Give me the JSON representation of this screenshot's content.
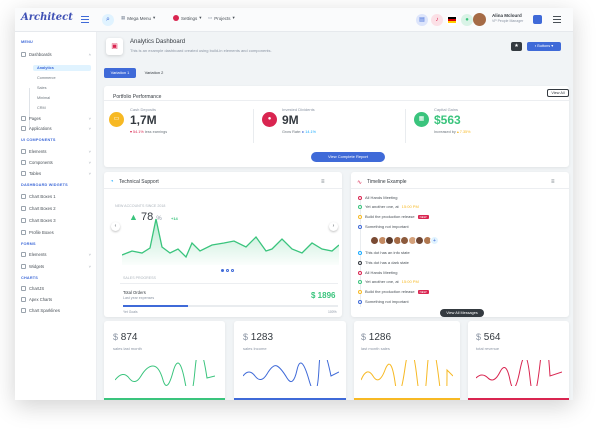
{
  "app": {
    "logo": "Architect"
  },
  "header": {
    "mega_menu": "Mega Menu",
    "settings": "Settings",
    "projects": "Projects",
    "user_name": "Alina Mclourd",
    "user_role": "VP People Manager"
  },
  "sidebar": {
    "menu_head": "MENU",
    "dashboards": "Dashboards",
    "dash_items": [
      "Analytics",
      "Commerce",
      "Sales",
      "Minimal",
      "CRM"
    ],
    "pages": "Pages",
    "applications": "Applications",
    "ui_head": "UI COMPONENTS",
    "elements": "Elements",
    "components": "Components",
    "tables": "Tables",
    "widgets_head": "DASHBOARD WIDGETS",
    "widgets": [
      "Chart Boxes 1",
      "Chart Boxes 2",
      "Chart Boxes 3",
      "Profile Boxes"
    ],
    "forms_head": "FORMS",
    "form_elements": "Elements",
    "form_widgets": "Widgets",
    "charts_head": "CHARTS",
    "charts": [
      "ChartJS",
      "Apex Charts",
      "Chart Sparklines"
    ]
  },
  "page": {
    "title": "Analytics Dashboard",
    "subtitle": "This is an example dashboard created using build-in elements and components.",
    "btn_label": "Buttons",
    "tabs": [
      "Variation 1",
      "Variation 2"
    ]
  },
  "portfolio": {
    "title": "Portfolio Performance",
    "view_all": "View All",
    "metrics": [
      {
        "label": "Cash Deposits",
        "value": "1,7M",
        "note_pct": "54.1%",
        "note": "less earnings",
        "color": "#f7b924"
      },
      {
        "label": "Invested Dividents",
        "value": "9M",
        "note": "Grow Rate:",
        "note_pct": "14.1%",
        "color": "#d92550"
      },
      {
        "label": "Capital Gains",
        "value": "$563",
        "note": "Increased by",
        "note_pct": "7.35%",
        "color": "#3ac47d"
      }
    ],
    "report_btn": "View Complete Report"
  },
  "support": {
    "title": "Technical Support",
    "new_accounts": "NEW ACCOUNTS SINCE 2018",
    "percent": "78",
    "percent_sign": "%",
    "delta": "+14",
    "sales_progress": "SALES PROGRESS",
    "orders_label": "Total Orders",
    "orders_sub": "Last year expenses",
    "orders_value": "$ 1896",
    "yet_to_go": "Yet Goals",
    "pct_label": "100%",
    "progress": 0.3
  },
  "timeline": {
    "title": "Timeline Example",
    "items": [
      {
        "text": "All Hands Meeting",
        "color": "#d92550"
      },
      {
        "text": "Yet another one, at",
        "time": "15:00 PM",
        "color": "#3ac47d"
      },
      {
        "text": "Build the production release",
        "badge": "NEW",
        "color": "#f7b924"
      },
      {
        "text": "Something not important",
        "color": "#3f6ad8"
      },
      {
        "text": "This dot has an info state",
        "color": "#16aaff"
      },
      {
        "text": "This dot has a dark state",
        "color": "#343a40"
      },
      {
        "text": "All Hands Meeting",
        "color": "#d92550"
      },
      {
        "text": "Yet another one, at",
        "time": "15:00 PM",
        "color": "#3ac47d"
      },
      {
        "text": "Build the production release",
        "badge": "NEW",
        "color": "#f7b924"
      },
      {
        "text": "Something not important",
        "color": "#3f6ad8"
      }
    ],
    "view_messages": "View All Messages"
  },
  "bottom": [
    {
      "dollar": "$",
      "value": "874",
      "label": "sales last month",
      "color": "#3ac47d"
    },
    {
      "dollar": "$",
      "value": "1283",
      "label": "sales Income",
      "color": "#3f6ad8"
    },
    {
      "dollar": "$",
      "value": "1286",
      "label": "last month sales",
      "color": "#f7b924"
    },
    {
      "dollar": "$",
      "value": "564",
      "label": "total revenue",
      "color": "#d92550"
    }
  ]
}
